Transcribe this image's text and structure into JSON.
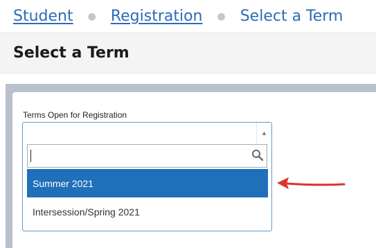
{
  "breadcrumb": {
    "items": [
      {
        "label": "Student"
      },
      {
        "label": "Registration"
      },
      {
        "label": "Select a Term"
      }
    ]
  },
  "page": {
    "title": "Select a Term"
  },
  "term_select": {
    "label": "Terms Open for Registration",
    "search_value": "",
    "options": [
      {
        "label": "Summer 2021",
        "selected": true
      },
      {
        "label": "Intersession/Spring 2021",
        "selected": false
      }
    ]
  },
  "icons": {
    "separator": "dot",
    "dropdown": "triangle-up-icon",
    "search": "magnifier-icon",
    "annotation": "red-arrow-left"
  },
  "colors": {
    "link": "#2b6bb8",
    "selected_bg": "#1f6fb9",
    "focus_border": "#5b9bd5",
    "annotation": "#e0322d",
    "panel": "#b8c2cc"
  }
}
